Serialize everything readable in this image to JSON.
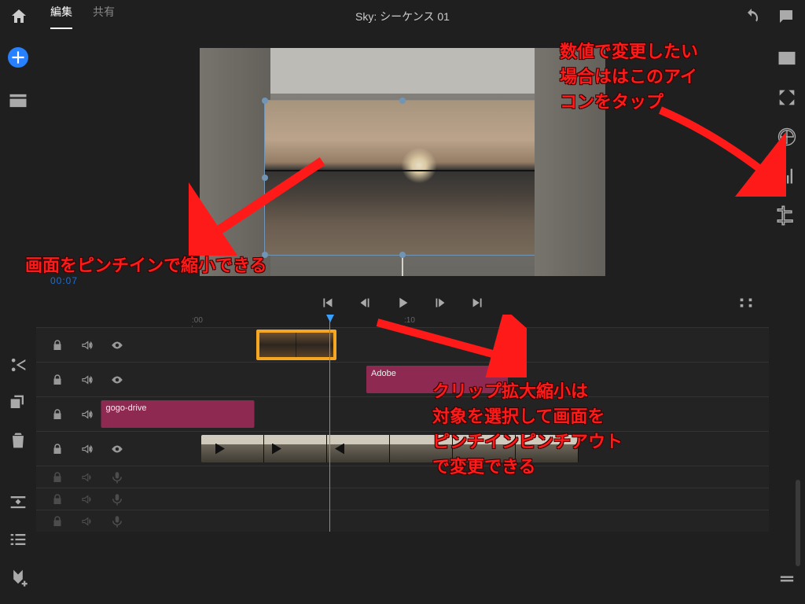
{
  "header": {
    "tabs": {
      "edit": "編集",
      "share": "共有"
    },
    "title": "Sky: シーケンス 01"
  },
  "preview": {
    "timecode": "00:07"
  },
  "ruler": {
    "t0": ":00",
    "t1": ":10"
  },
  "tracks": {
    "clip_selected": "",
    "clip_adobe": "Adobe",
    "clip_gogo": "gogo-drive"
  },
  "annotations": {
    "top_right": "数値で変更したい\n場合ははこのアイ\nコンをタップ",
    "left": "画面をピンチインで縮小できる",
    "bottom": "クリップ拡大縮小は\n対象を選択して画面を\nピンチインピンチアウト\nで変更できる"
  },
  "colors": {
    "accent_blue": "#3aa0ff",
    "accent_orange": "#f5a623",
    "clip_title": "#8e2a52",
    "anno_red": "#ff1a1a"
  }
}
